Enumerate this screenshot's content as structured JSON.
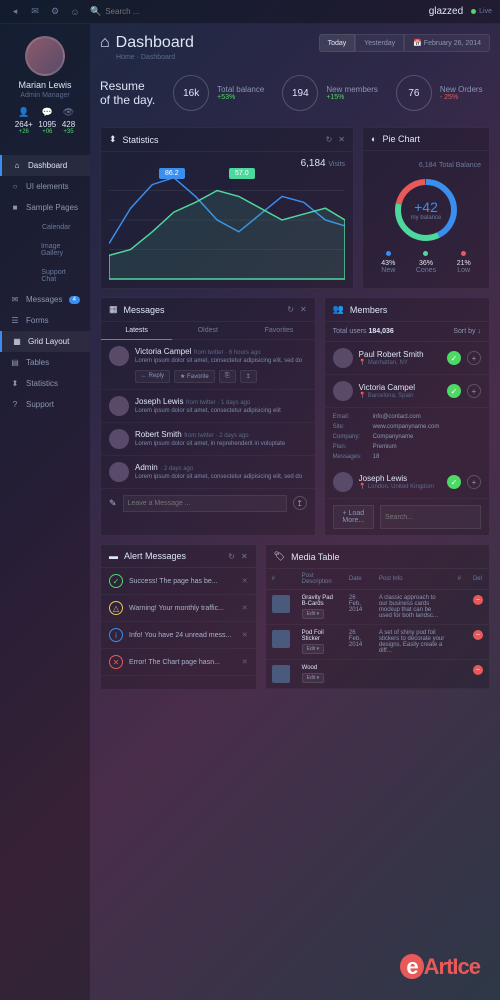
{
  "brand": "glazzed",
  "live_label": "Live",
  "search": {
    "placeholder": "Search ..."
  },
  "profile": {
    "name": "Marian Lewis",
    "role": "Admin Manager",
    "stats": [
      {
        "icon": "👤",
        "value": "264+",
        "delta": "+26"
      },
      {
        "icon": "💬",
        "value": "1095",
        "delta": "+06"
      },
      {
        "icon": "👁",
        "value": "428",
        "delta": "+35"
      }
    ]
  },
  "nav": {
    "items": [
      {
        "icon": "⌂",
        "label": "Dashboard",
        "active": true
      },
      {
        "icon": "○",
        "label": "UI elements"
      },
      {
        "icon": "■",
        "label": "Sample Pages"
      },
      {
        "icon": "",
        "label": "Calendar",
        "sub": true
      },
      {
        "icon": "",
        "label": "Image Gallery",
        "sub": true
      },
      {
        "icon": "",
        "label": "Support Chat",
        "sub": true
      },
      {
        "icon": "✉",
        "label": "Messages",
        "badge": "4"
      },
      {
        "icon": "☰",
        "label": "Forms"
      },
      {
        "icon": "▦",
        "label": "Grid Layout",
        "active": true
      },
      {
        "icon": "▤",
        "label": "Tables"
      },
      {
        "icon": "⬍",
        "label": "Statistics"
      },
      {
        "icon": "?",
        "label": "Support"
      }
    ]
  },
  "header": {
    "title": "Dashboard",
    "breadcrumb": "Home · Dashboard",
    "date_buttons": [
      "Today",
      "Yesterday"
    ],
    "date_picker": "February 26, 2014"
  },
  "resume": {
    "title": "Resume\nof the day.",
    "kpis": [
      {
        "value": "16k",
        "label": "Total balance",
        "delta": "+53%",
        "neg": false
      },
      {
        "value": "194",
        "label": "New members",
        "delta": "+15%",
        "neg": false
      },
      {
        "value": "76",
        "label": "New Orders",
        "delta": "- 25%",
        "neg": true
      }
    ]
  },
  "stats_panel": {
    "title": "Statistics",
    "visits_value": "6,184",
    "visits_label": "Visits",
    "tooltip1": "86.2",
    "tooltip2": "57.0"
  },
  "pie_panel": {
    "title": "Pie Chart",
    "total_value": "6,184",
    "total_label": "Total Balance",
    "center_value": "+42",
    "center_label": "my balance",
    "legend": [
      {
        "value": "43%",
        "label": "New",
        "color": "#3a8eed"
      },
      {
        "value": "36%",
        "label": "Cones",
        "color": "#4dd99e"
      },
      {
        "value": "21%",
        "label": "Low",
        "color": "#e85a5a"
      }
    ]
  },
  "messages_panel": {
    "title": "Messages",
    "tabs": [
      "Latests",
      "Oldest",
      "Favorites"
    ],
    "items": [
      {
        "name": "Victoria Campel",
        "meta": "from twitter · 6 hours ago",
        "text": "Lorem ipsum dolor sit amet, consectetur adipisicing elit, sed do",
        "actions": [
          "← Reply",
          "★ Favorite",
          "⎘",
          "↥"
        ]
      },
      {
        "name": "Joseph Lewis",
        "meta": "from twitter · 1 days ago",
        "text": "Lorem ipsum dolor sit amet, consectetur adipisicing elit"
      },
      {
        "name": "Robert Smith",
        "meta": "from twitter · 2 days ago",
        "text": "Lorem ipsum dolor sit amet, in reprehenderit in voluptate"
      },
      {
        "name": "Admin",
        "meta": "· 2 days ago",
        "text": "Lorem ipsum dolor sit amet, consectetur adipisicing elit, sed do"
      }
    ],
    "input_placeholder": "Leave a Message ..."
  },
  "members_panel": {
    "title": "Members",
    "total_label": "Total users",
    "total_value": "184,036",
    "sort_label": "Sort by ↓",
    "items": [
      {
        "name": "Paul Robert Smith",
        "loc": "📍 Manhattan, NY"
      },
      {
        "name": "Victoria Campel",
        "loc": "📍 Barcelona, Spain",
        "expanded": true,
        "details": [
          {
            "k": "Email:",
            "v": "info@contact.com"
          },
          {
            "k": "Site:",
            "v": "www.companyname.com"
          },
          {
            "k": "Company:",
            "v": "Companyname"
          },
          {
            "k": "Plan:",
            "v": "Premium"
          },
          {
            "k": "Messages:",
            "v": "18"
          }
        ]
      },
      {
        "name": "Joseph Lewis",
        "loc": "📍 London, United Kingdom"
      }
    ],
    "load_more": "+ Load More...",
    "search_placeholder": "Search..."
  },
  "alerts_panel": {
    "title": "Alert Messages",
    "items": [
      {
        "type": "success",
        "icon": "✓",
        "text": "Success! The page has be..."
      },
      {
        "type": "warning",
        "icon": "△",
        "text": "Warning! Your monthly traffic..."
      },
      {
        "type": "info",
        "icon": "i",
        "text": "Info! You have 24 unread mess..."
      },
      {
        "type": "error",
        "icon": "✕",
        "text": "Error! The Chart page hasn..."
      }
    ]
  },
  "media_panel": {
    "title": "Media Table",
    "headers": [
      "#",
      "Post Description",
      "Date",
      "Post Info",
      "#",
      "Del"
    ],
    "rows": [
      {
        "title": "Gravity Pad B-Cards",
        "date": "26 Feb, 2014",
        "info": "A classic approach to our business cards mockup that can be used for both landsc..."
      },
      {
        "title": "Pod Foil Sticker",
        "date": "26 Feb, 2014",
        "info": "A set of shiny pod foil stickers to decorate your designs. Easily create a diff..."
      },
      {
        "title": "Wood",
        "date": "",
        "info": ""
      }
    ],
    "edit_label": "Edit ▾"
  },
  "chart_data": {
    "statistics": {
      "type": "line",
      "x": [
        0,
        1,
        2,
        3,
        4,
        5,
        6,
        7,
        8,
        9,
        10,
        11
      ],
      "series": [
        {
          "name": "blue",
          "color": "#3a8eed",
          "values": [
            30,
            60,
            80,
            86,
            70,
            50,
            40,
            55,
            70,
            65,
            50,
            45
          ]
        },
        {
          "name": "green",
          "color": "#4dd99e",
          "values": [
            20,
            25,
            40,
            57,
            65,
            75,
            70,
            60,
            50,
            55,
            60,
            50
          ]
        }
      ],
      "ylim": [
        0,
        100
      ]
    },
    "pie": {
      "type": "pie",
      "slices": [
        {
          "label": "New",
          "value": 43,
          "color": "#3a8eed"
        },
        {
          "label": "Cones",
          "value": 36,
          "color": "#4dd99e"
        },
        {
          "label": "Low",
          "value": 21,
          "color": "#e85a5a"
        }
      ]
    }
  },
  "watermark": "eArtIce"
}
